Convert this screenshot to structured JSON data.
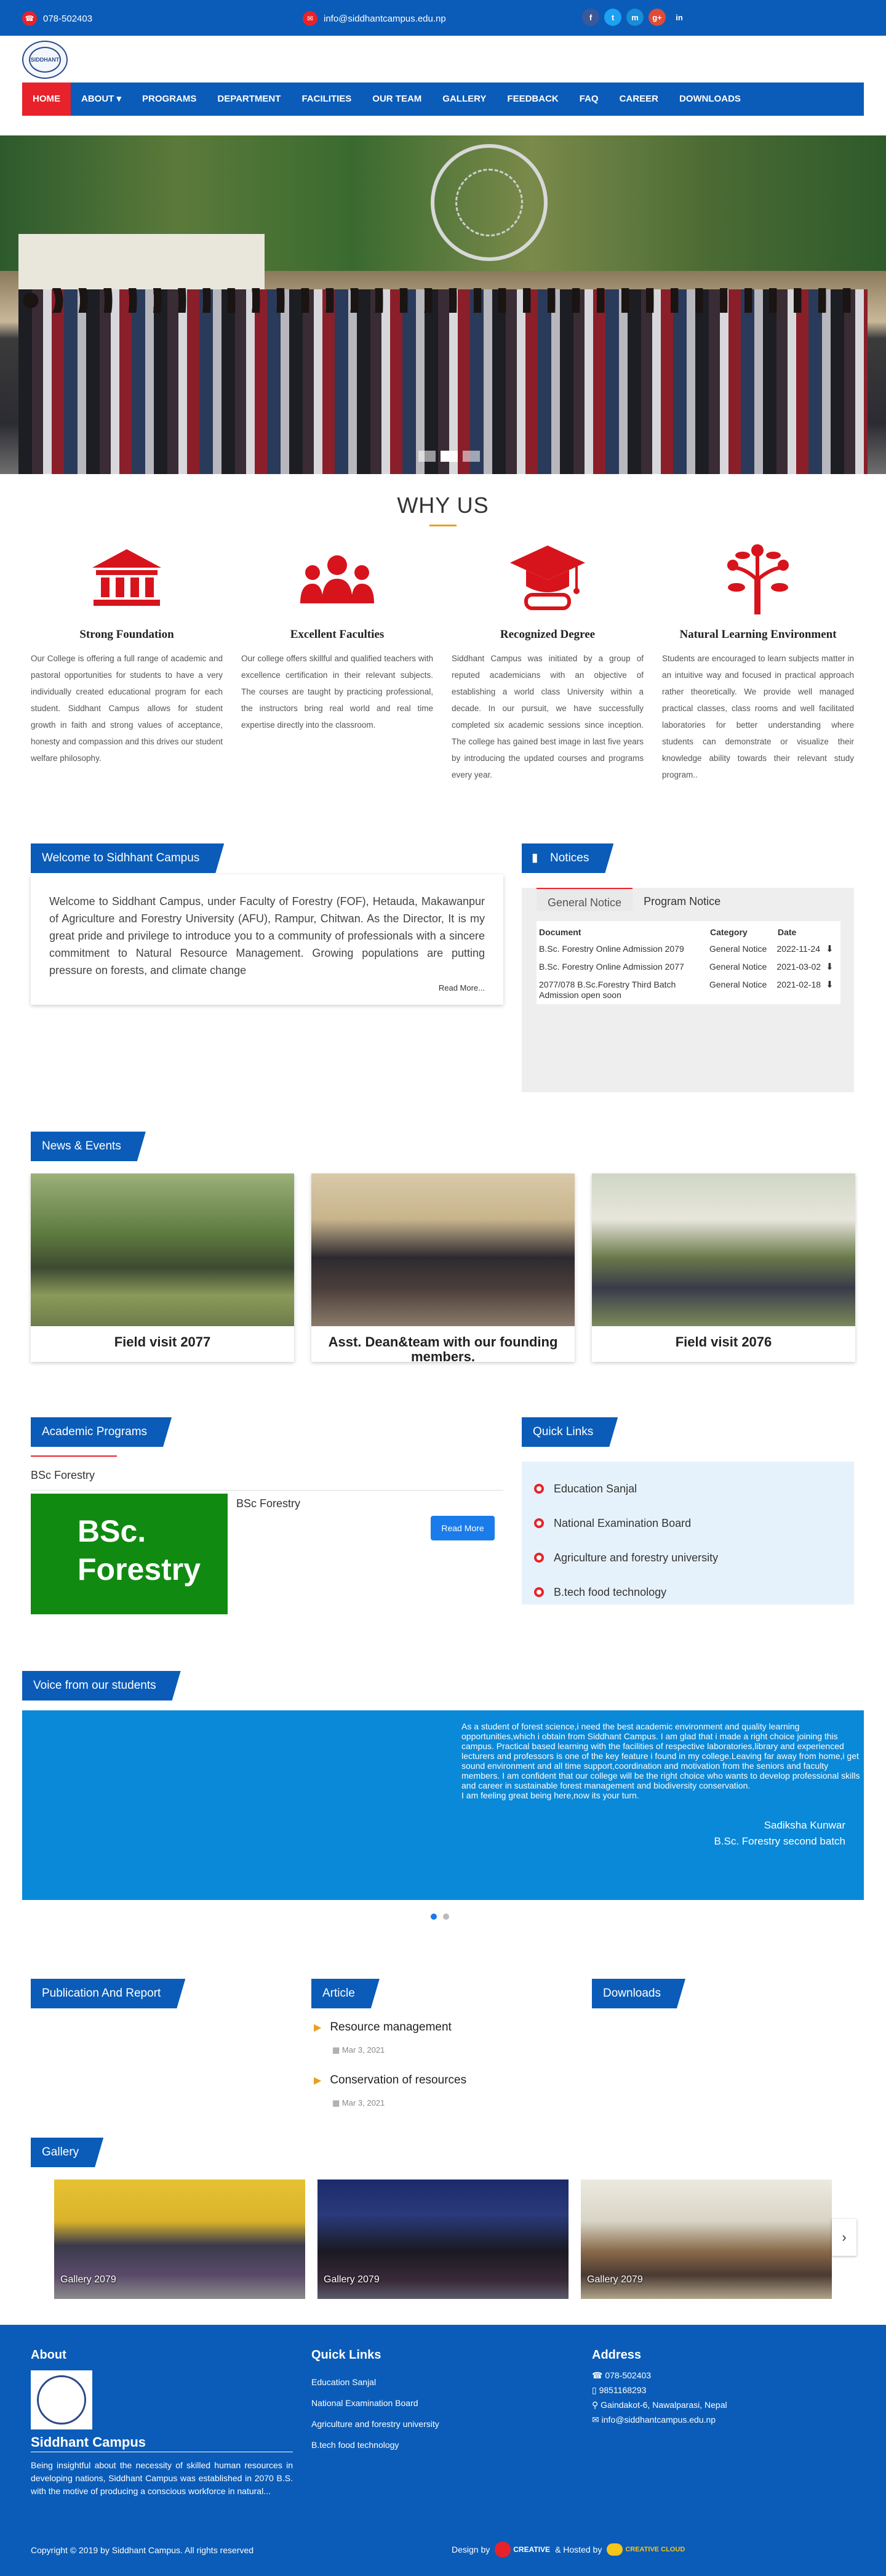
{
  "topbar": {
    "phone": "078-502403",
    "email": "info@siddhantcampus.edu.np",
    "social": [
      "f",
      "t",
      "m",
      "g+",
      "in"
    ]
  },
  "logo": {
    "text": "SIDDHANT"
  },
  "nav": {
    "items": [
      "HOME",
      "ABOUT ▾",
      "PROGRAMS",
      "DEPARTMENT",
      "FACILITIES",
      "OUR TEAM",
      "GALLERY",
      "FEEDBACK",
      "FAQ",
      "CAREER",
      "DOWNLOADS"
    ]
  },
  "why": {
    "title": "WHY US",
    "items": [
      {
        "title": "Strong Foundation",
        "text": "Our College is offering a full range of academic and pastoral opportunities for students to have a very individually created educational program for each student. Siddhant Campus allows for student growth in faith and strong values of acceptance, honesty and compassion and this drives our student welfare philosophy."
      },
      {
        "title": "Excellent Faculties",
        "text": "Our college offers skillful and qualified teachers with excellence certification in their relevant subjects. The courses are taught by practicing professional, the instructors bring real world and real time expertise directly into the classroom."
      },
      {
        "title": "Recognized Degree",
        "text": "Siddhant Campus was initiated by a group of reputed academicians with an objective of establishing a world class University within a decade. In our pursuit, we have successfully completed six academic sessions since inception. The college has gained best image in last five years by introducing the updated courses and programs every year."
      },
      {
        "title": "Natural Learning Environment",
        "text": "Students are encouraged to learn subjects matter in an intuitive way and focused in practical approach rather theoretically. We provide well managed practical classes, class rooms and well facilitated laboratories for better understanding where students can demonstrate or visualize their knowledge ability towards their relevant study program.."
      }
    ]
  },
  "welcome": {
    "tag": "Welcome to Sidhhant Campus",
    "text": "Welcome to Siddhant Campus, under Faculty of Forestry (FOF), Hetauda, Makawanpur of Agriculture and Forestry University (AFU), Rampur, Chitwan. As the Director, It is my great pride and privilege to introduce you to a community of professionals with a sincere commitment to Natural Resource Management. Growing populations are putting pressure on forests, and climate change",
    "read_more": "Read More..."
  },
  "notices": {
    "tag": "Notices",
    "tabs": [
      "General Notice",
      "Program Notice"
    ],
    "headers": [
      "Document",
      "Category",
      "Date"
    ],
    "rows": [
      {
        "doc": "B.Sc. Forestry Online Admission 2079",
        "cat": "General Notice",
        "date": "2022-11-24"
      },
      {
        "doc": "B.Sc. Forestry Online Admission 2077",
        "cat": "General Notice",
        "date": "2021-03-02"
      },
      {
        "doc": "2077/078 B.Sc.Forestry Third Batch Admission open soon",
        "cat": "General Notice",
        "date": "2021-02-18"
      }
    ]
  },
  "news": {
    "tag": "News & Events",
    "items": [
      {
        "title": "Field visit 2077"
      },
      {
        "title": "Asst. Dean&team with our founding members."
      },
      {
        "title": "Field visit 2076"
      }
    ]
  },
  "academic": {
    "tag": "Academic Programs",
    "tab": "BSc Forestry",
    "card_title": "BSc Forestry",
    "image_text": "BSc. Forestry",
    "button": "Read More"
  },
  "quick_links": {
    "tag": "Quick Links",
    "items": [
      "Education Sanjal",
      "National Examination Board",
      "Agriculture and forestry university",
      "B.tech food technology"
    ]
  },
  "voice": {
    "tag": "Voice from our students",
    "text": "As a student of forest science,i need the best academic environment and quality learning opportunities,which i obtain from Siddhant Campus. I am glad that i made a right choice joining this campus. Practical based learning with the facilities of respective laboratories,library and experienced lecturers and professors is one of the key feature i found in my college.Leaving far away from home,i get sound environment and all time support,coordination and motivation from the seniors and faculty members. I am confident that our college will be the right choice who wants to develop professional skills and career in sustainable forest management and biodiversity conservation.\nI am feeling great being here,now its your turn.",
    "name": "Sadiksha Kunwar",
    "role": "B.Sc. Forestry second batch"
  },
  "publication": {
    "tag": "Publication And Report"
  },
  "article": {
    "tag": "Article",
    "items": [
      {
        "title": "Resource management",
        "date": "Mar 3, 2021"
      },
      {
        "title": "Conservation of resources",
        "date": "Mar 3, 2021"
      }
    ]
  },
  "downloads": {
    "tag": "Downloads"
  },
  "gallery": {
    "tag": "Gallery",
    "items": [
      "Gallery 2079",
      "Gallery 2079",
      "Gallery 2079"
    ]
  },
  "footer": {
    "about_title": "About",
    "campus_name": "Siddhant Campus",
    "about_text": "Being insightful about the necessity of skilled human resources in developing nations, Siddhant Campus was established in 2070 B.S. with the motive of producing a conscious workforce in natural...",
    "quick_title": "Quick Links",
    "quick_items": [
      "Education Sanjal",
      "National Examination Board",
      "Agriculture and forestry university",
      "B.tech food technology"
    ],
    "address_title": "Address",
    "address_items": [
      "078-502403",
      "9851168293",
      "Gaindakot-6, Nawalparasi, Nepal",
      "info@siddhantcampus.edu.np"
    ],
    "copyright": "Copyright © 2019 by Siddhant Campus. All rights reserved",
    "design_by": "Design by",
    "creative_a": "CREATIVE",
    "hosted_by": "& Hosted by",
    "creative_b": "CREATIVE CLOUD"
  },
  "colors": {
    "primary": "#0a5cb8",
    "accent": "#e8222a",
    "gold": "#e8a020",
    "voice_bg": "#0a89d8",
    "program_green": "#118a12"
  }
}
